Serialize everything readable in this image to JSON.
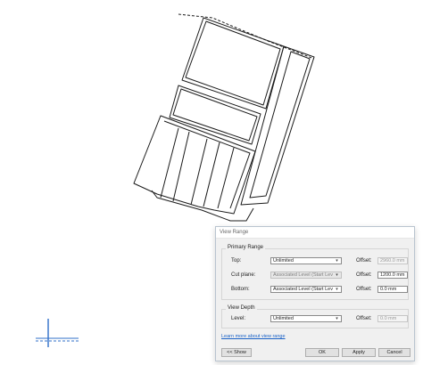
{
  "drawing": {
    "ucs_icon": "ucs-icon"
  },
  "dialog": {
    "title": "View Range",
    "primary_range": {
      "heading": "Primary Range",
      "top": {
        "label": "Top:",
        "value": "Unlimited",
        "offset_label": "Offset:",
        "offset": "2960.0 mm",
        "offset_disabled": true
      },
      "cut_plane": {
        "label": "Cut plane:",
        "value": "Associated Level (Start Lev",
        "offset_label": "Offset:",
        "offset": "1200.0 mm",
        "disabled": true
      },
      "bottom": {
        "label": "Bottom:",
        "value": "Associated Level (Start Lev",
        "offset_label": "Offset:",
        "offset": "0.0 mm"
      }
    },
    "view_depth": {
      "heading": "View Depth",
      "level": {
        "label": "Level:",
        "value": "Unlimited",
        "offset_label": "Offset:",
        "offset": "0.0 mm",
        "offset_disabled": true
      }
    },
    "learn_more": "Learn more about view range",
    "buttons": {
      "show": "<< Show",
      "ok": "OK",
      "apply": "Apply",
      "cancel": "Cancel"
    }
  }
}
